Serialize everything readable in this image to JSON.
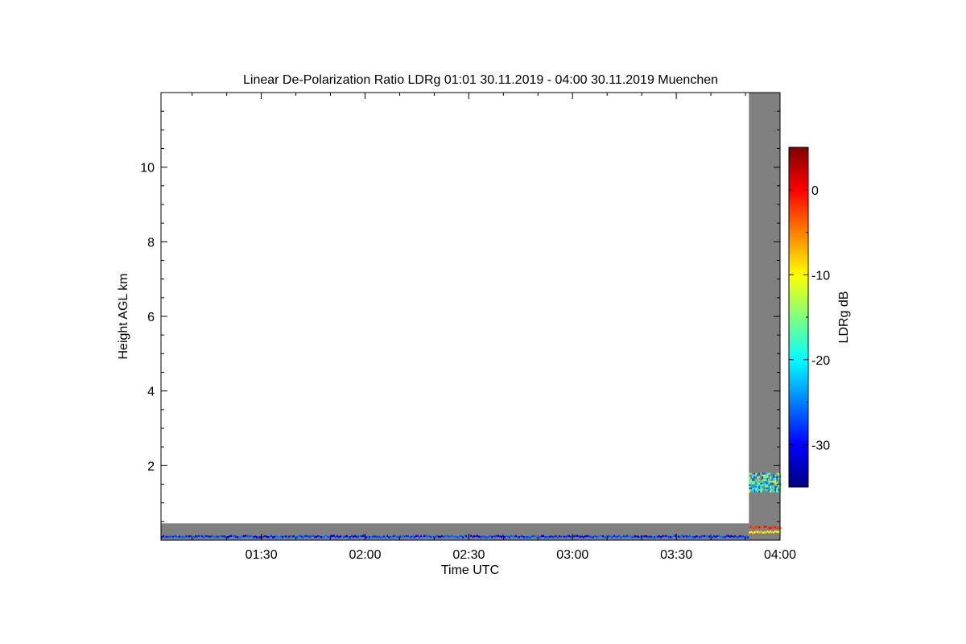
{
  "chart_data": {
    "type": "heatmap",
    "title": "Linear De-Polarization Ratio LDRg   01:01 30.11.2019 - 04:00 30.11.2019 Muenchen",
    "xlabel": "Time UTC",
    "ylabel": "Height AGL km",
    "colorbar_label": "LDRg dB",
    "x_range": [
      "01:01",
      "04:00"
    ],
    "x_ticks": [
      "01:30",
      "02:00",
      "02:30",
      "03:00",
      "03:30",
      "04:00"
    ],
    "ylim": [
      0,
      12
    ],
    "y_ticks": [
      2,
      4,
      6,
      8,
      10
    ],
    "colorbar_range": [
      -35,
      5
    ],
    "colorbar_ticks": [
      0,
      -10,
      -20,
      -30
    ],
    "colormap": [
      "#00007f",
      "#0000ff",
      "#0080ff",
      "#00ffff",
      "#80ff80",
      "#ffff00",
      "#ff8000",
      "#ff0000",
      "#7f0000"
    ],
    "no_data_color": "#808080",
    "regions": [
      {
        "description": "gray near-ground band",
        "t_start": "01:01",
        "t_end": "03:51",
        "h_bottom": 0.0,
        "h_top": 0.45,
        "color": "#808080"
      },
      {
        "description": "blue low-level LDR trace",
        "t_start": "01:01",
        "t_end": "03:51",
        "h": 0.1,
        "ldr_db": -28
      },
      {
        "description": "gray column",
        "t_start": "03:51",
        "t_end": "04:00",
        "h_bottom": 0.0,
        "h_top": 12.0,
        "color": "#808080"
      },
      {
        "description": "cloud layer",
        "t_start": "03:51",
        "t_end": "04:00",
        "h_bottom": 1.3,
        "h_top": 1.8,
        "ldr_db_range": [
          -28,
          -10
        ]
      },
      {
        "description": "orange line near ground",
        "t_start": "03:51",
        "t_end": "04:00",
        "h": 0.35,
        "ldr_db": -2
      },
      {
        "description": "yellow line near ground",
        "t_start": "03:51",
        "t_end": "04:00",
        "h": 0.22,
        "ldr_db": -10
      }
    ]
  }
}
